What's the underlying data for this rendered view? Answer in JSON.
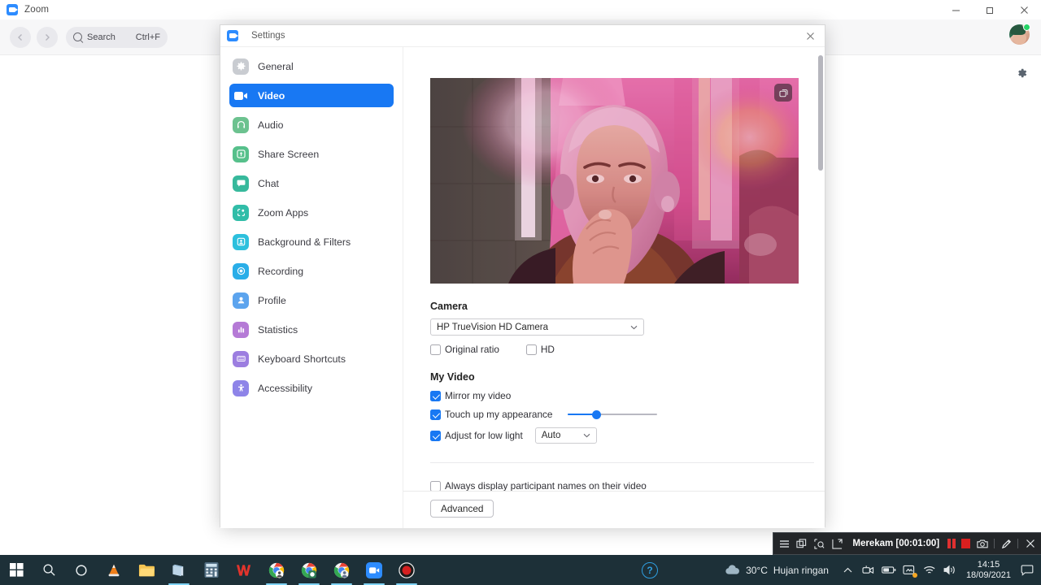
{
  "zoom_window": {
    "title": "Zoom",
    "icon": "zoom-logo-icon",
    "window_controls": {
      "minimize": "—",
      "maximize": "❐",
      "close": "✕"
    },
    "toolbar": {
      "back_icon": "chevron-left-icon",
      "forward_icon": "chevron-right-icon",
      "search_icon": "search-icon",
      "search_label": "Search",
      "search_shortcut": "Ctrl+F"
    },
    "avatar": {
      "name": "user-avatar",
      "status": "available",
      "status_color": "#25d366"
    },
    "settings_gear_icon": "gear-icon"
  },
  "settings_dialog": {
    "title": "Settings",
    "icon": "zoom-logo-icon",
    "close_label": "✕",
    "sidebar": {
      "items": [
        {
          "label": "General",
          "icon": "gear-icon",
          "color": "#c9ccd1",
          "active": false
        },
        {
          "label": "Video",
          "icon": "video-camera-icon",
          "color": "#1878f3",
          "active": true
        },
        {
          "label": "Audio",
          "icon": "headset-icon",
          "color": "#6cc28f",
          "active": false
        },
        {
          "label": "Share Screen",
          "icon": "share-screen-icon",
          "color": "#56c08b",
          "active": false
        },
        {
          "label": "Chat",
          "icon": "chat-bubble-icon",
          "color": "#37b99c",
          "active": false
        },
        {
          "label": "Zoom Apps",
          "icon": "zoom-apps-icon",
          "color": "#31bda8",
          "active": false
        },
        {
          "label": "Background & Filters",
          "icon": "background-icon",
          "color": "#2dc0dd",
          "active": false
        },
        {
          "label": "Recording",
          "icon": "record-icon",
          "color": "#2aaee8",
          "active": false
        },
        {
          "label": "Profile",
          "icon": "person-icon",
          "color": "#5ca4ee",
          "active": false
        },
        {
          "label": "Statistics",
          "icon": "bar-chart-icon",
          "color": "#b57ad6",
          "active": false
        },
        {
          "label": "Keyboard Shortcuts",
          "icon": "keyboard-icon",
          "color": "#9c7ee0",
          "active": false
        },
        {
          "label": "Accessibility",
          "icon": "accessibility-icon",
          "color": "#8e84e8",
          "active": false
        }
      ]
    },
    "video_panel": {
      "preview": {
        "name": "camera-preview",
        "snapshot_icon": "snapshot-icon"
      },
      "camera": {
        "heading": "Camera",
        "selected_device": "HP TrueVision HD Camera",
        "dropdown_icon": "chevron-down-icon",
        "checkboxes": [
          {
            "label": "Original ratio",
            "checked": false
          },
          {
            "label": "HD",
            "checked": false
          }
        ]
      },
      "my_video": {
        "heading": "My Video",
        "mirror": {
          "label": "Mirror my video",
          "checked": true
        },
        "touch_up": {
          "label": "Touch up my appearance",
          "checked": true,
          "slider_value": 32
        },
        "low_light": {
          "label": "Adjust for low light",
          "checked": true,
          "selected_mode": "Auto",
          "dropdown_icon": "chevron-down-icon"
        }
      },
      "participant_names": {
        "label": "Always display participant names on their video",
        "checked": false
      },
      "advanced_button": "Advanced"
    }
  },
  "recorder_bar": {
    "menu_icon": "hamburger-menu-icon",
    "window_icon": "window-select-icon",
    "region_icon": "region-select-icon",
    "fullscreen_icon": "fullscreen-select-icon",
    "status_text": "Merekam [00:01:00]",
    "pause_icon": "pause-icon",
    "stop_icon": "stop-icon",
    "camera_icon": "screenshot-camera-icon",
    "pen_icon": "pen-icon",
    "close_icon": "close-icon"
  },
  "taskbar": {
    "start_icon": "windows-start-icon",
    "pinned": [
      {
        "name": "search-icon",
        "open": false
      },
      {
        "name": "cortana-icon",
        "open": false
      },
      {
        "name": "vlc-icon",
        "open": false
      },
      {
        "name": "file-explorer-icon",
        "open": false
      },
      {
        "name": "store-icon",
        "open": true
      },
      {
        "name": "calculator-icon",
        "open": false
      },
      {
        "name": "wps-office-icon",
        "open": false
      },
      {
        "name": "chrome-profile-1-icon",
        "open": true
      },
      {
        "name": "chrome-profile-2-icon",
        "open": true
      },
      {
        "name": "chrome-profile-3-icon",
        "open": true
      },
      {
        "name": "zoom-icon",
        "open": true
      },
      {
        "name": "recorder-icon",
        "open": true
      }
    ],
    "tray": {
      "help_icon": "help-circle-icon",
      "weather_icon": "cloud-icon",
      "temperature": "30°C",
      "weather_text": "Hujan ringan",
      "chevron_icon": "chevron-up-icon",
      "icons": [
        "camera-privacy-icon",
        "battery-icon",
        "display-icon",
        "wifi-icon",
        "speaker-icon"
      ],
      "time": "14:15",
      "date": "18/09/2021",
      "action_center_icon": "notification-icon"
    }
  }
}
